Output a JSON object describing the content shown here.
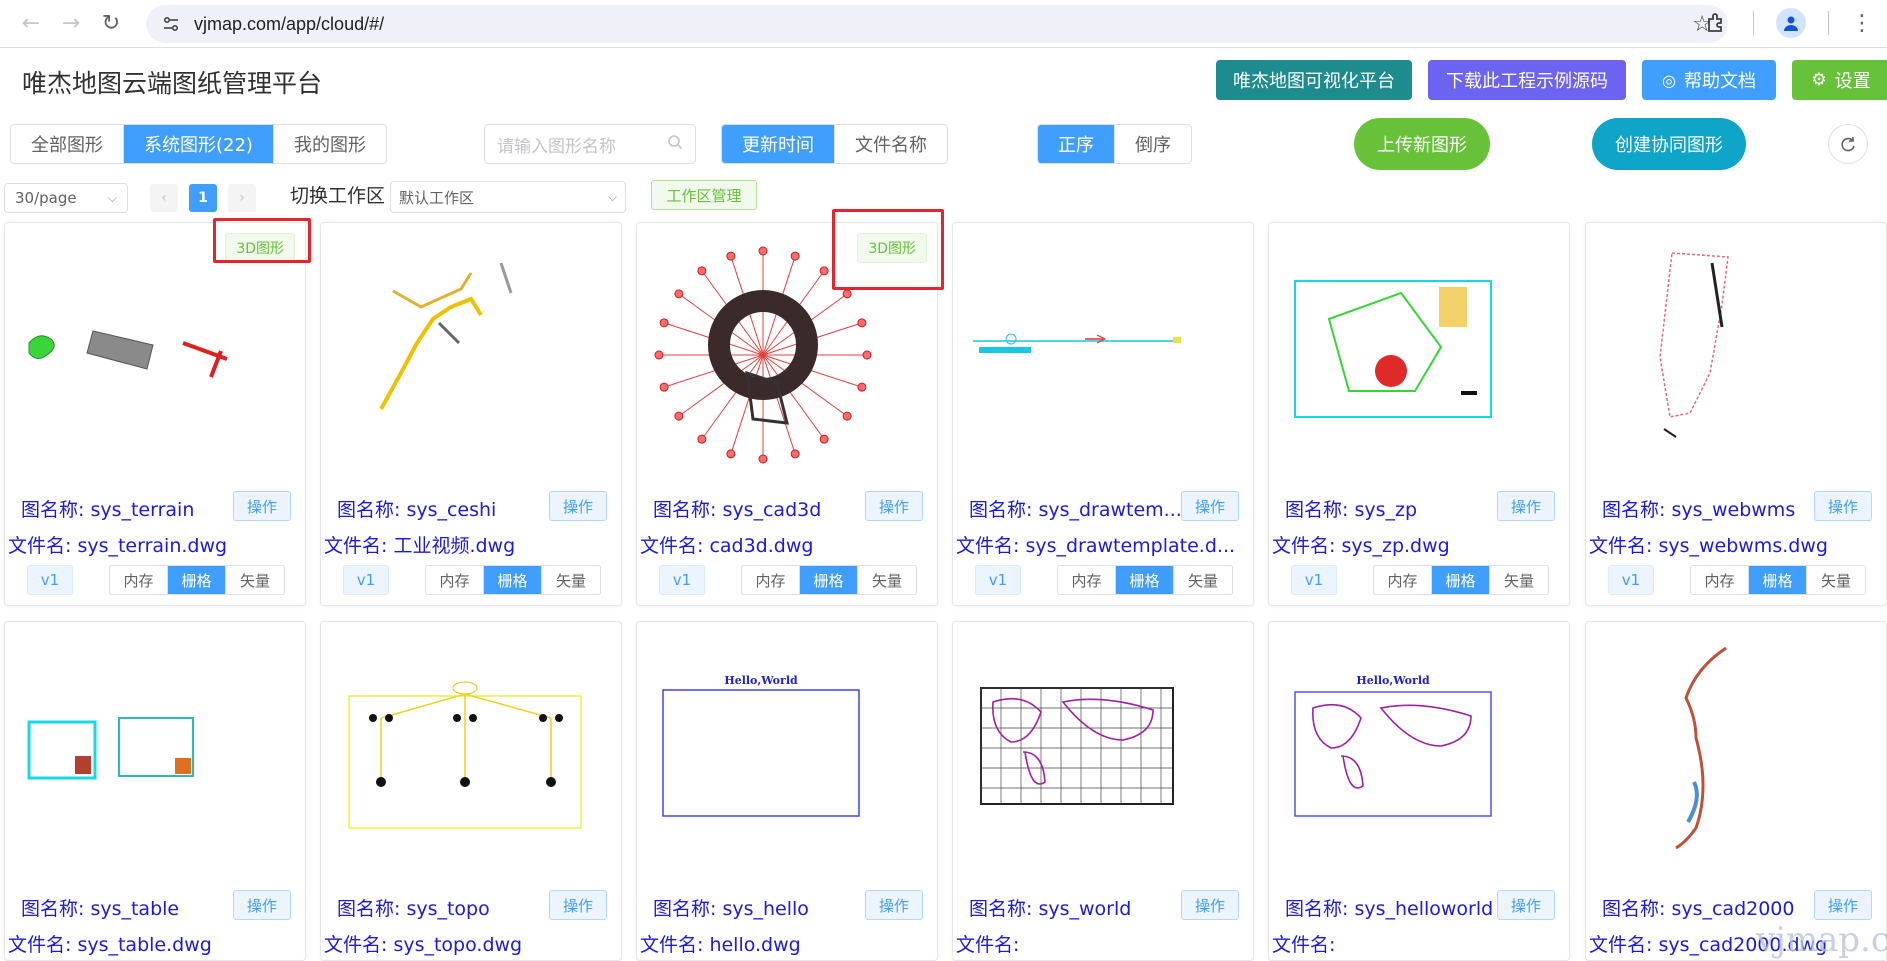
{
  "browser": {
    "url": "vjmap.com/app/cloud/#/"
  },
  "header": {
    "title": "唯杰地图云端图纸管理平台",
    "buttons": [
      {
        "label": "唯杰地图可视化平台",
        "color": "#1e8b8f"
      },
      {
        "label": "下载此工程示例源码",
        "color": "#6c63f0"
      },
      {
        "label": "帮助文档",
        "color": "#409eff"
      },
      {
        "label": "设置",
        "color": "#67c23a"
      }
    ]
  },
  "toolbar": {
    "scope_tabs": [
      "全部图形",
      "系统图形(22)",
      "我的图形"
    ],
    "scope_active": 1,
    "search_placeholder": "请输入图形名称",
    "sort_field_tabs": [
      "更新时间",
      "文件名称"
    ],
    "sort_order_tabs": [
      "正序",
      "倒序"
    ],
    "upload_label": "上传新图形",
    "create_label": "创建协同图形"
  },
  "pager": {
    "page_size": "30/page",
    "current_page": "1",
    "workspace_label": "切换工作区",
    "workspace_value": "默认工作区",
    "workspace_manage": "工作区管理"
  },
  "card_labels": {
    "map_prefix": "图名称: ",
    "file_prefix": "文件名: ",
    "op": "操作",
    "badge_3d": "3D图形",
    "modes": [
      "内存",
      "栅格",
      "矢量"
    ],
    "active_mode": 1,
    "version": "v1"
  },
  "cards": [
    {
      "map_name": "图名称: sys_terrain",
      "file_name": "文件名: sys_terrain.dwg",
      "badge": "3D图形",
      "thumb": "terrain-drawing"
    },
    {
      "map_name": "图名称: sys_ceshi",
      "file_name": "文件名: 工业视频.dwg",
      "badge": "",
      "thumb": "ceshi-drawing"
    },
    {
      "map_name": "图名称: sys_cad3d",
      "file_name": "文件名: cad3d.dwg",
      "badge": "3D图形",
      "thumb": "cad3d-drawing"
    },
    {
      "map_name": "图名称: sys_drawtem...",
      "file_name": "文件名: sys_drawtemplate.d...",
      "badge": "",
      "thumb": "drawtemplate-drawing"
    },
    {
      "map_name": "图名称: sys_zp",
      "file_name": "文件名: sys_zp.dwg",
      "badge": "",
      "thumb": "zp-drawing"
    },
    {
      "map_name": "图名称: sys_webwms",
      "file_name": "文件名: sys_webwms.dwg",
      "badge": "",
      "thumb": "webwms-drawing"
    },
    {
      "map_name": "图名称: sys_table",
      "file_name": "文件名: sys_table.dwg",
      "badge": "",
      "thumb": "table-drawing"
    },
    {
      "map_name": "图名称: sys_topo",
      "file_name": "文件名: sys_topo.dwg",
      "badge": "",
      "thumb": "topo-drawing"
    },
    {
      "map_name": "图名称: sys_hello",
      "file_name": "文件名: hello.dwg",
      "badge": "",
      "thumb": "hello-drawing",
      "thumb_text": "Hello,World"
    },
    {
      "map_name": "图名称: sys_world",
      "file_name": "文件名:",
      "badge": "",
      "thumb": "world-drawing"
    },
    {
      "map_name": "图名称: sys_helloworld",
      "file_name": "文件名:",
      "badge": "",
      "thumb": "helloworld-drawing",
      "thumb_text": "Hello,World"
    },
    {
      "map_name": "图名称: sys_cad2000",
      "file_name": "文件名: sys_cad2000.dwg",
      "badge": "",
      "thumb": "cad2000-drawing"
    }
  ],
  "watermark": "vjmap.com",
  "colors": {
    "primary": "#409eff",
    "success": "#67c23a",
    "link_text": "#1a1ae0",
    "highlight": "#e4262c",
    "upload": "#67c23a",
    "create": "#0ea5c9"
  }
}
